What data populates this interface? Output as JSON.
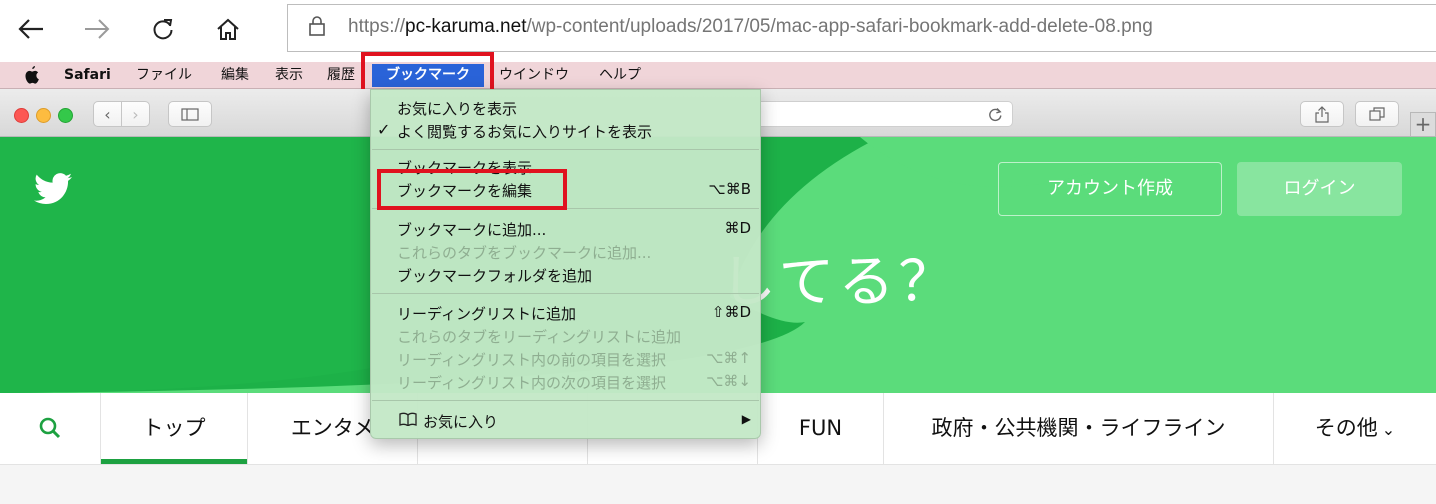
{
  "browser": {
    "url_host": "pc-karuma.net",
    "url_rest": "/wp-content/uploads/2017/05/mac-app-safari-bookmark-add-delete-08.png",
    "url_scheme": "https://"
  },
  "menubar": {
    "app": "Safari",
    "items": [
      "ファイル",
      "編集",
      "表示",
      "履歴",
      "ブックマーク",
      "ウインドウ",
      "ヘルプ"
    ]
  },
  "hero": {
    "text": "してる？",
    "signup": "アカウント作成",
    "login": "ログイン"
  },
  "tabs": [
    "トップ",
    "エンタメ",
    "FUN",
    "政府・公共機関・ライフライン",
    "その他"
  ],
  "bookmark_menu": {
    "items": [
      {
        "label": "お気に入りを表示",
        "shortcut": "",
        "disabled": false,
        "checked": false
      },
      {
        "label": "よく閲覧するお気に入りサイトを表示",
        "shortcut": "",
        "disabled": false,
        "checked": true
      },
      {
        "label": "ブックマークを表示",
        "shortcut": "",
        "disabled": false,
        "checked": false
      },
      {
        "label": "ブックマークを編集",
        "shortcut": "⌥⌘B",
        "disabled": false,
        "checked": false
      },
      {
        "label": "ブックマークに追加...",
        "shortcut": "⌘D",
        "disabled": false,
        "checked": false
      },
      {
        "label": "これらのタブをブックマークに追加...",
        "shortcut": "",
        "disabled": true,
        "checked": false
      },
      {
        "label": "ブックマークフォルダを追加",
        "shortcut": "",
        "disabled": false,
        "checked": false
      },
      {
        "label": "リーディングリストに追加",
        "shortcut": "⇧⌘D",
        "disabled": false,
        "checked": false
      },
      {
        "label": "これらのタブをリーディングリストに追加",
        "shortcut": "",
        "disabled": true,
        "checked": false
      },
      {
        "label": "リーディングリスト内の前の項目を選択",
        "shortcut": "⌥⌘↑",
        "disabled": true,
        "checked": false
      },
      {
        "label": "リーディングリスト内の次の項目を選択",
        "shortcut": "⌥⌘↓",
        "disabled": true,
        "checked": false
      },
      {
        "label": "お気に入り",
        "shortcut": "▶",
        "disabled": false,
        "checked": false
      }
    ],
    "checkmark": "✓"
  },
  "colors": {
    "menu_highlight": "#2a63d8",
    "annotation_red": "#e0121f",
    "twitter_green": "#1da141"
  }
}
